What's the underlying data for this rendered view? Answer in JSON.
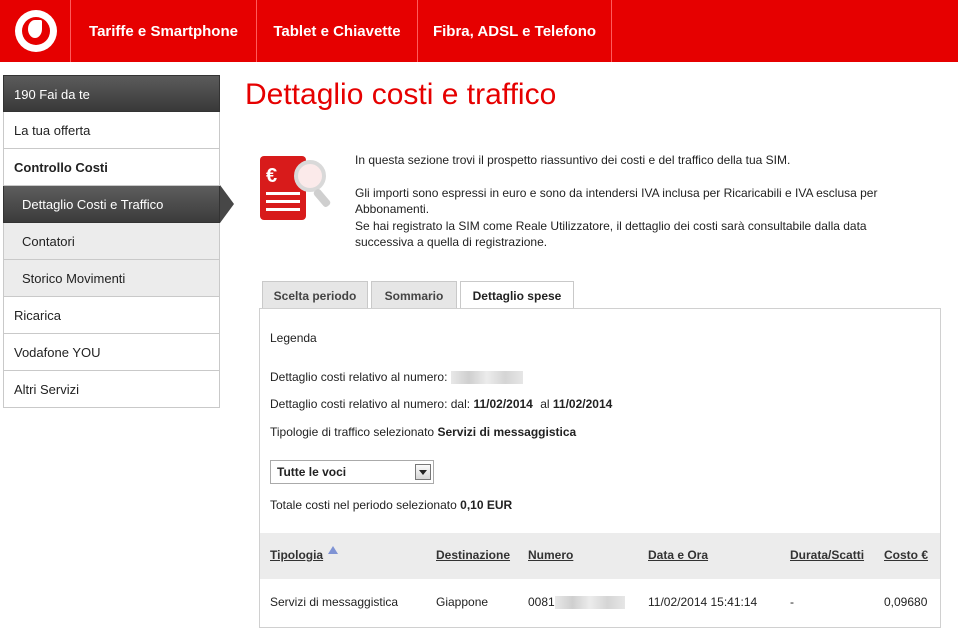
{
  "header": {
    "logo": "vodafone-logo",
    "nav": [
      "Tariffe e Smartphone",
      "Tablet e Chiavette",
      "Fibra, ADSL e Telefono"
    ],
    "brand_color": "#e60000"
  },
  "sidebar": {
    "items": [
      {
        "label": "190 Fai da te"
      },
      {
        "label": "La tua offerta"
      },
      {
        "label": "Controllo Costi"
      },
      {
        "label": "Dettaglio Costi e Traffico"
      },
      {
        "label": "Contatori"
      },
      {
        "label": "Storico Movimenti"
      },
      {
        "label": "Ricarica"
      },
      {
        "label": "Vodafone YOU"
      },
      {
        "label": "Altri Servizi"
      }
    ]
  },
  "main": {
    "title": "Dettaglio costi e traffico",
    "icon": "euro-document-search-icon",
    "intro": [
      "In questa sezione trovi il prospetto riassuntivo dei costi e del traffico della tua SIM.",
      "Gli importi sono espressi in euro e sono da intendersi IVA inclusa per Ricaricabili e IVA esclusa per Abbonamenti.",
      "Se hai registrato la SIM come Reale Utilizzatore, il dettaglio dei costi sarà consultabile dalla data successiva a quella di registrazione."
    ],
    "tabs": [
      "Scelta periodo",
      "Sommario",
      "Dettaglio spese"
    ],
    "legend": "Legenda",
    "numero_label": "Dettaglio costi relativo al numero:",
    "periodo_label": "Dettaglio costi relativo al numero: dal:",
    "date_from": "11/02/2014",
    "al_label": "al",
    "date_to": "11/02/2014",
    "tipologie_label": "Tipologie di traffico selezionato",
    "tipologie_value": "Servizi di messaggistica",
    "select_value": "Tutte le voci",
    "totale_label": "Totale costi nel periodo selezionato",
    "totale_value": "0,10 EUR",
    "table": {
      "headers": [
        "Tipologia",
        "Destinazione",
        "Numero",
        "Data e Ora",
        "Durata/Scatti",
        "Costo €"
      ],
      "rows": [
        [
          "Servizi di messaggistica",
          "Giappone",
          "0081",
          "11/02/2014 15:41:14",
          "-",
          "0,09680"
        ]
      ]
    }
  }
}
